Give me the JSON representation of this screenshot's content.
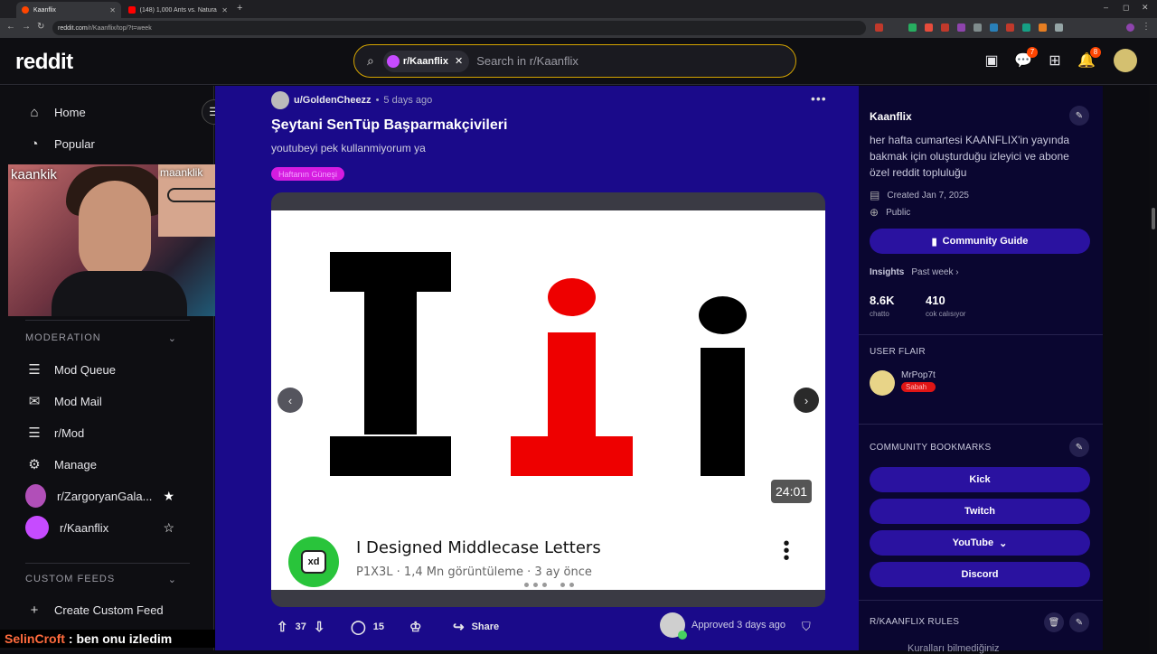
{
  "browser": {
    "tabs": [
      {
        "title": "Kaanflix"
      },
      {
        "title": "(148) 1,000 Ants vs. Natural D..."
      }
    ],
    "url_host": "reddit.com",
    "url_path": "/r/Kaanflix/top/?t=week"
  },
  "header": {
    "logo": "reddit",
    "search": {
      "chip_label": "r/Kaanflix",
      "placeholder": "Search in r/Kaanflix"
    },
    "chat_badge": "7",
    "notif_badge": "8"
  },
  "sidebar": {
    "home": "Home",
    "popular": "Popular",
    "moderation_heading": "MODERATION",
    "mod_items": [
      {
        "label": "Mod Queue"
      },
      {
        "label": "Mod Mail"
      },
      {
        "label": "r/Mod"
      },
      {
        "label": "Manage"
      },
      {
        "label": "r/ZargoryanGala..."
      },
      {
        "label": "r/Kaanflix"
      }
    ],
    "custom_feeds_heading": "CUSTOM FEEDS",
    "create_custom_feed": "Create Custom Feed"
  },
  "overlay": {
    "cam_label_main": "kaankik",
    "cam_label_inset": "maanklik",
    "chat_user": "SelinCroft",
    "chat_message": ": ben onu izledim"
  },
  "post": {
    "author": "u/GoldenCheezz",
    "time": "5 days ago",
    "title": "Şeytani SenTüp Başparmakçivileri",
    "body": "youtubeyi pek kullanmiyorum ya",
    "flair": "Haftanın Güneşi",
    "video": {
      "duration": "24:01",
      "title": "I Designed Middlecase Letters",
      "channel_line": "P1X3L · 1,4 Mn görüntüleme · 3 ay önce",
      "avatar_text": "xd"
    },
    "carousel_active_index": 3,
    "carousel_count": 6,
    "upvotes": "37",
    "comments": "15",
    "share": "Share",
    "approved": "Approved 3 days ago"
  },
  "community": {
    "name": "Kaanflix",
    "description": "her hafta cumartesi KAANFLIX'in yayında bakmak için oluşturduğu izleyici ve abone özel reddit topluluğu",
    "created": "Created Jan 7, 2025",
    "visibility": "Public",
    "guide_button": "Community Guide",
    "insights_label": "Insights",
    "insights_period": "Past week ›",
    "stats": [
      {
        "value": "8.6K",
        "label": "chatto"
      },
      {
        "value": "410",
        "label": "cok calısıyor"
      }
    ],
    "user_flair_heading": "USER FLAIR",
    "flair_user": "MrPop7t",
    "flair_badge": "Sabah",
    "bookmarks_heading": "COMMUNITY BOOKMARKS",
    "bookmarks": [
      {
        "label": "Kick"
      },
      {
        "label": "Twitch"
      },
      {
        "label": "YouTube"
      },
      {
        "label": "Discord"
      }
    ],
    "rules_heading": "R/KAANFLIX RULES",
    "rules_peek": "Kuralları bilmediğiniz"
  },
  "colors": {
    "feed_bg": "#1a0a8a",
    "sidebar_right_bg": "#0a0630",
    "button_bg": "#2a12a0",
    "flair_pink": "#d51ce0",
    "search_border": "#d4a400",
    "brand_orange": "#ff4500"
  }
}
